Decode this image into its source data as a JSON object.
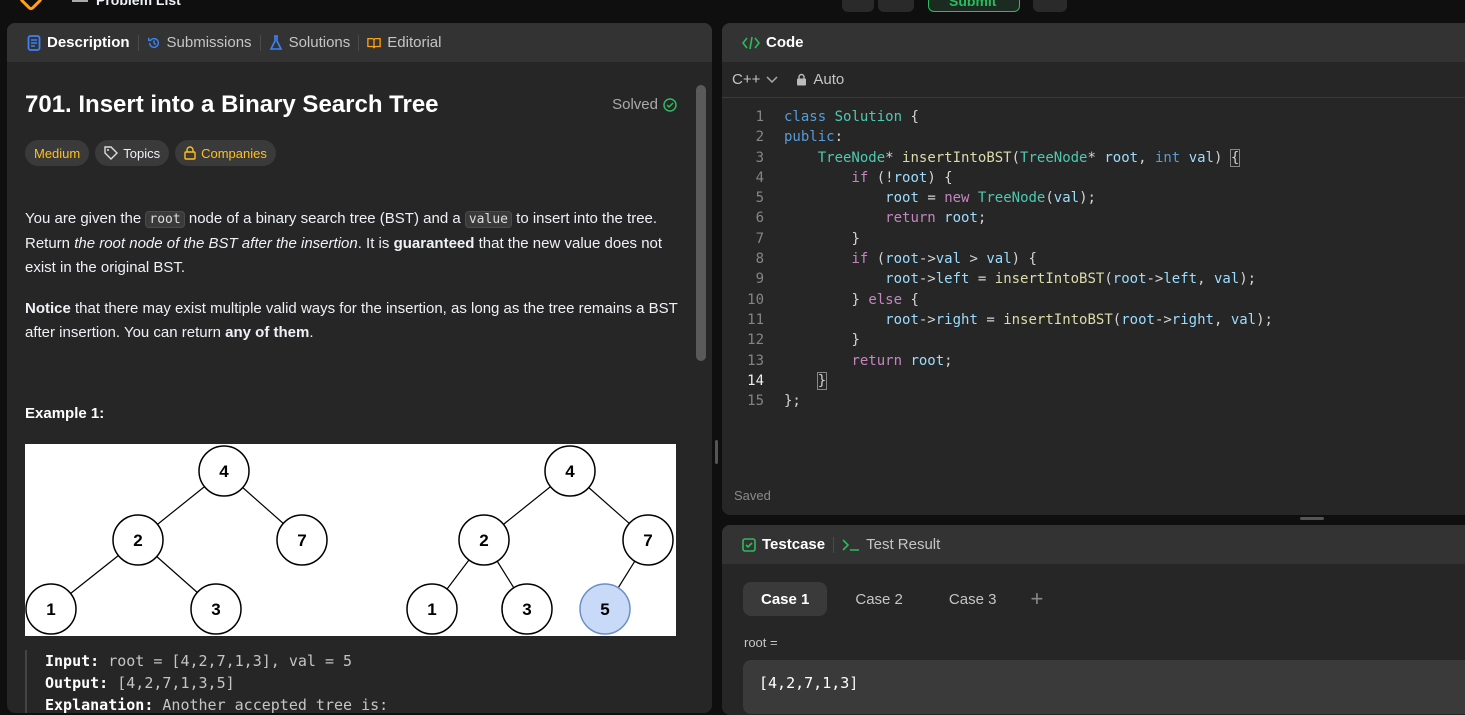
{
  "topbar": {
    "problem_list": "Problem List",
    "submit": "Submit"
  },
  "left_tabs": [
    {
      "label": "Description",
      "icon": "description-icon"
    },
    {
      "label": "Submissions",
      "icon": "history-icon"
    },
    {
      "label": "Solutions",
      "icon": "flask-icon"
    },
    {
      "label": "Editorial",
      "icon": "book-icon"
    }
  ],
  "problem": {
    "title": "701. Insert into a Binary Search Tree",
    "status": "Solved",
    "difficulty": "Medium",
    "topics": "Topics",
    "companies": "Companies",
    "p1_a": "You are given the ",
    "p1_code1": "root",
    "p1_b": " node of a binary search tree (BST) and a ",
    "p1_code2": "value",
    "p1_c": " to insert into the tree. Return ",
    "p1_i": "the root node of the BST after the insertion",
    "p1_d": ". It is ",
    "p1_bold": "guaranteed",
    "p1_e": " that the new value does not exist in the original BST.",
    "p2_bold1": "Notice",
    "p2_a": " that there may exist multiple valid ways for the insertion, as long as the tree remains a BST after insertion. You can return ",
    "p2_bold2": "any of them",
    "p2_b": ".",
    "example_title": "Example 1:",
    "input_label": "Input:",
    "input_value": " root = [4,2,7,1,3], val = 5",
    "output_label": "Output:",
    "output_value": " [4,2,7,1,3,5]",
    "explanation_label": "Explanation:",
    "explanation_value": " Another accepted tree is:",
    "tree_left": [
      "4",
      "2",
      "7",
      "1",
      "3"
    ],
    "tree_right": [
      "4",
      "2",
      "7",
      "1",
      "3",
      "5"
    ]
  },
  "code_panel": {
    "title": "Code",
    "language": "C++",
    "mode": "Auto",
    "saved": "Saved",
    "line_numbers": [
      "1",
      "2",
      "3",
      "4",
      "5",
      "6",
      "7",
      "8",
      "9",
      "10",
      "11",
      "12",
      "13",
      "14",
      "15"
    ]
  },
  "test_panel": {
    "tab_testcase": "Testcase",
    "tab_result": "Test Result",
    "cases": [
      "Case 1",
      "Case 2",
      "Case 3"
    ],
    "root_label": "root =",
    "root_value": "[4,2,7,1,3]"
  },
  "colors": {
    "medium": "#ffc01e",
    "solved": "#2cbb5d",
    "keyword": "#569cd6",
    "type": "#4ec9b0"
  }
}
